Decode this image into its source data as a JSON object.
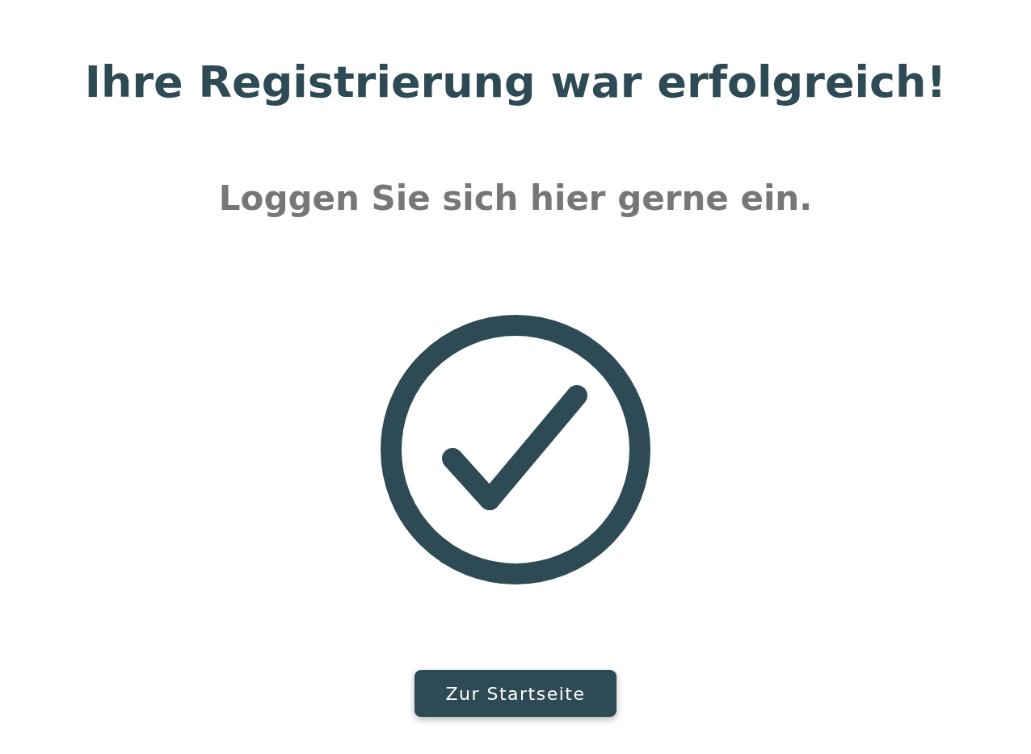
{
  "title": "Ihre Registrierung war erfolgreich!",
  "subtitle": "Loggen Sie sich hier gerne ein.",
  "button": {
    "label": "Zur Startseite"
  }
}
